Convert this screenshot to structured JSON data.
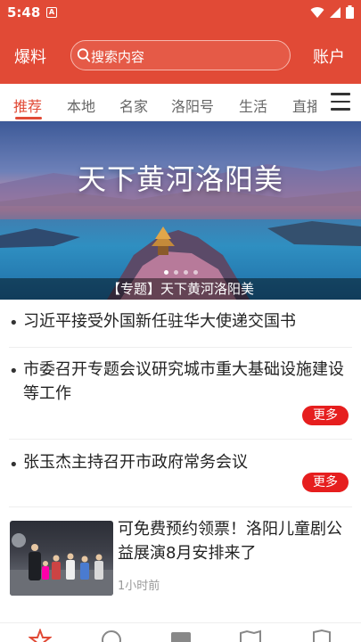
{
  "status_bar": {
    "time": "5:48",
    "notification_badge": "A"
  },
  "app_bar": {
    "left_label": "爆料",
    "right_label": "账户"
  },
  "search": {
    "placeholder": "搜索内容"
  },
  "tabs": [
    "推荐",
    "本地",
    "名家",
    "洛阳号",
    "生活",
    "直播"
  ],
  "active_tab": 0,
  "banner": {
    "title": "天下黄河洛阳美",
    "caption": "【专题】天下黄河洛阳美",
    "slide_count": 4,
    "active_slide": 0
  },
  "news": [
    {
      "title": "习近平接受外国新任驻华大使递交国书"
    },
    {
      "title": "市委召开专题会议研究城市重大基础设施建设等工作",
      "more": "更多"
    },
    {
      "title": "张玉杰主持召开市政府常务会议",
      "more": "更多"
    }
  ],
  "video_card": {
    "title": "可免费预约领票！洛阳儿童剧公益展演8月安排来了",
    "time": "1小时前"
  },
  "bottom_nav": [
    {
      "icon": "star-icon"
    },
    {
      "icon": "compass-icon"
    },
    {
      "icon": "grid-icon"
    },
    {
      "icon": "map-icon"
    },
    {
      "icon": "shield-icon"
    }
  ],
  "colors": {
    "brand": "#e14a36",
    "more_button": "#e61e1e"
  }
}
